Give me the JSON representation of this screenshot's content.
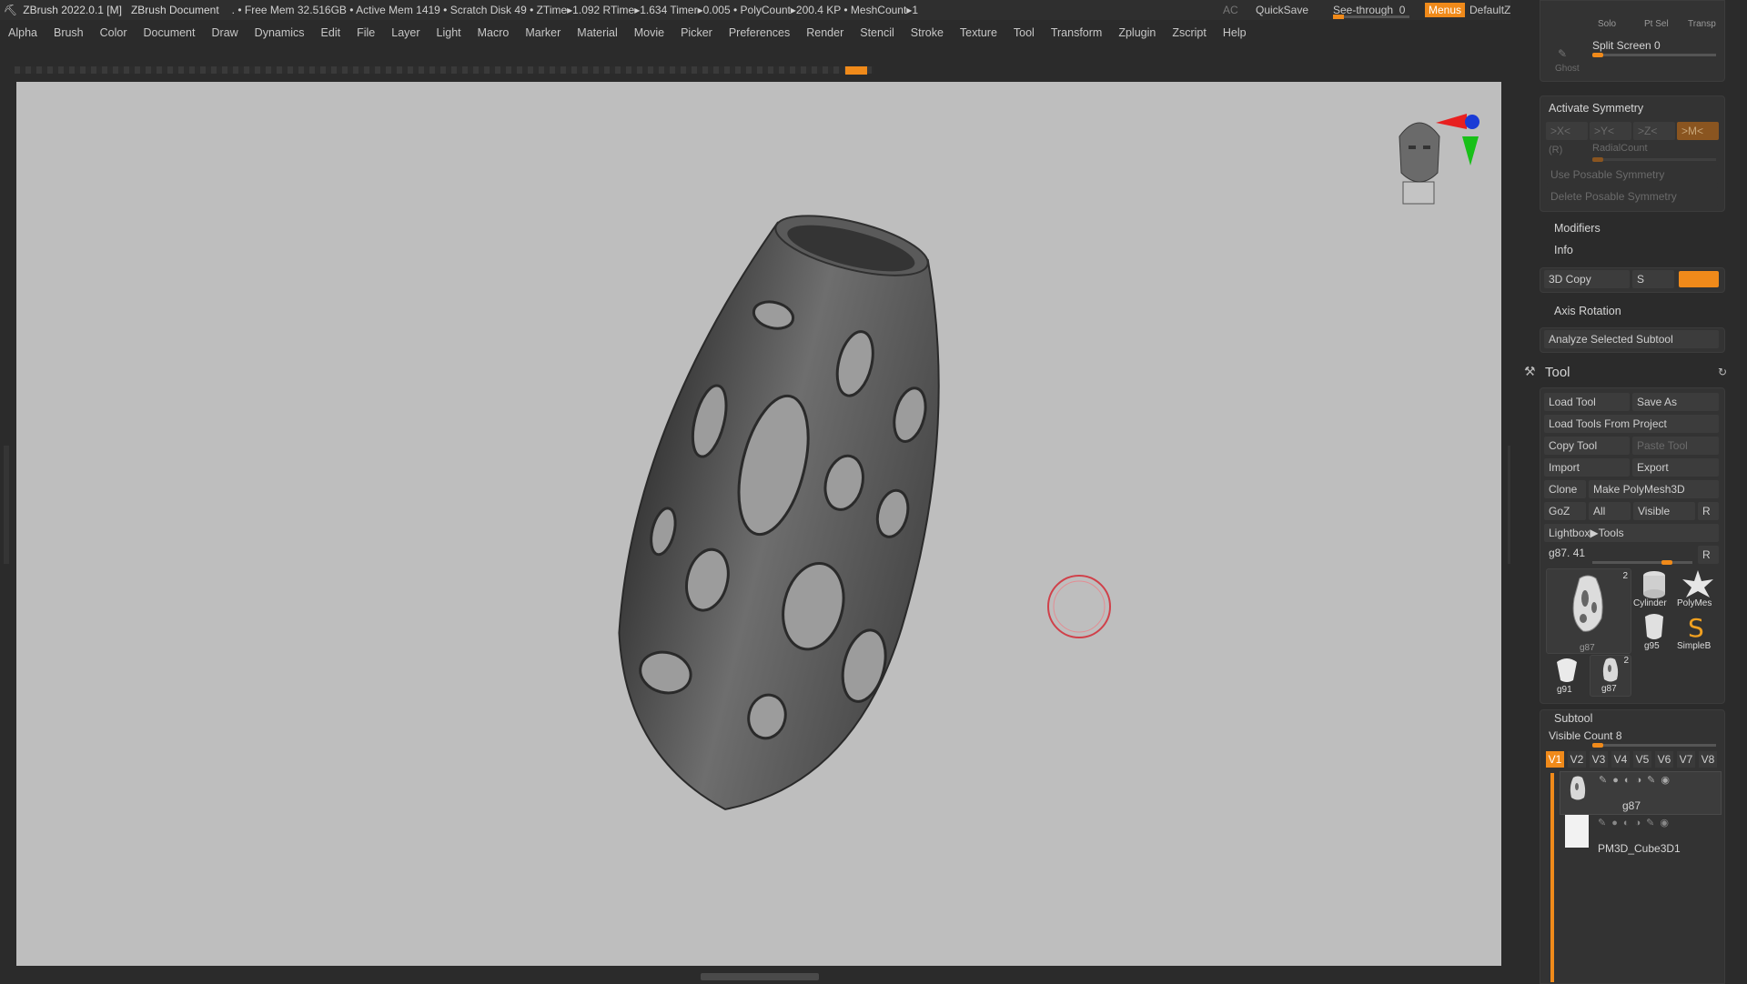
{
  "titlebar": {
    "app": "ZBrush 2022.0.1 [M]",
    "document": "ZBrush Document",
    "stats": ". • Free Mem 32.516GB • Active Mem 1419 • Scratch Disk 49 • ZTime▸1.092 RTime▸1.634 Timer▸0.005 • PolyCount▸200.4 KP • MeshCount▸1",
    "ac": "AC",
    "quicksave": "QuickSave",
    "see_through_label": "See-through",
    "see_through_value": "0",
    "see_through_level": 0,
    "menus": "Menus",
    "zscript": "DefaultZScript"
  },
  "menubar": {
    "items": [
      "Alpha",
      "Brush",
      "Color",
      "Document",
      "Draw",
      "Dynamics",
      "Edit",
      "File",
      "Layer",
      "Light",
      "Macro",
      "Marker",
      "Material",
      "Movie",
      "Picker",
      "Preferences",
      "Render",
      "Stencil",
      "Stroke",
      "Texture",
      "Tool",
      "Transform",
      "Zplugin",
      "Zscript",
      "Help"
    ]
  },
  "panel": {
    "top_buttons": [
      "Solo",
      "Pt Sel",
      "Transp"
    ],
    "ghost": "Ghost",
    "split_screen": "Split Screen 0",
    "symmetry": {
      "title": "Activate Symmetry",
      "axes": [
        ">X<",
        ">Y<",
        ">Z<",
        ">M<"
      ],
      "r": "(R)",
      "radial": "RadialCount",
      "posable": "Use Posable Symmetry",
      "delete_posable": "Delete Posable Symmetry"
    },
    "modifiers": "Modifiers",
    "info": "Info",
    "copy3d": "3D Copy",
    "s": "S",
    "axis_rotation": "Axis Rotation",
    "analyze": "Analyze Selected Subtool",
    "tool_title": "Tool",
    "tool_buttons": {
      "load": "Load Tool",
      "save_as": "Save As",
      "load_project": "Load Tools From Project",
      "copy": "Copy Tool",
      "paste": "Paste Tool",
      "import": "Import",
      "export": "Export",
      "clone": "Clone",
      "make_polymesh": "Make PolyMesh3D",
      "goz": "GoZ",
      "all": "All",
      "visible": "Visible",
      "r": "R",
      "lightbox": "Lightbox▶Tools",
      "current": "g87. 41",
      "r2": "R"
    },
    "thumbs": [
      {
        "label": "g87",
        "badge": "2"
      },
      {
        "label": "Cylinder"
      },
      {
        "label": "PolyMes"
      },
      {
        "label": "g95"
      },
      {
        "label": "SimpleB"
      },
      {
        "label": "g91"
      },
      {
        "label": "g87",
        "badge": "2"
      }
    ],
    "subtool": {
      "title": "Subtool",
      "visible_count": "Visible Count 8",
      "tabs": [
        "V1",
        "V2",
        "V3",
        "V4",
        "V5",
        "V6",
        "V7",
        "V8"
      ],
      "items": [
        "g87",
        "PM3D_Cube3D1"
      ]
    }
  }
}
